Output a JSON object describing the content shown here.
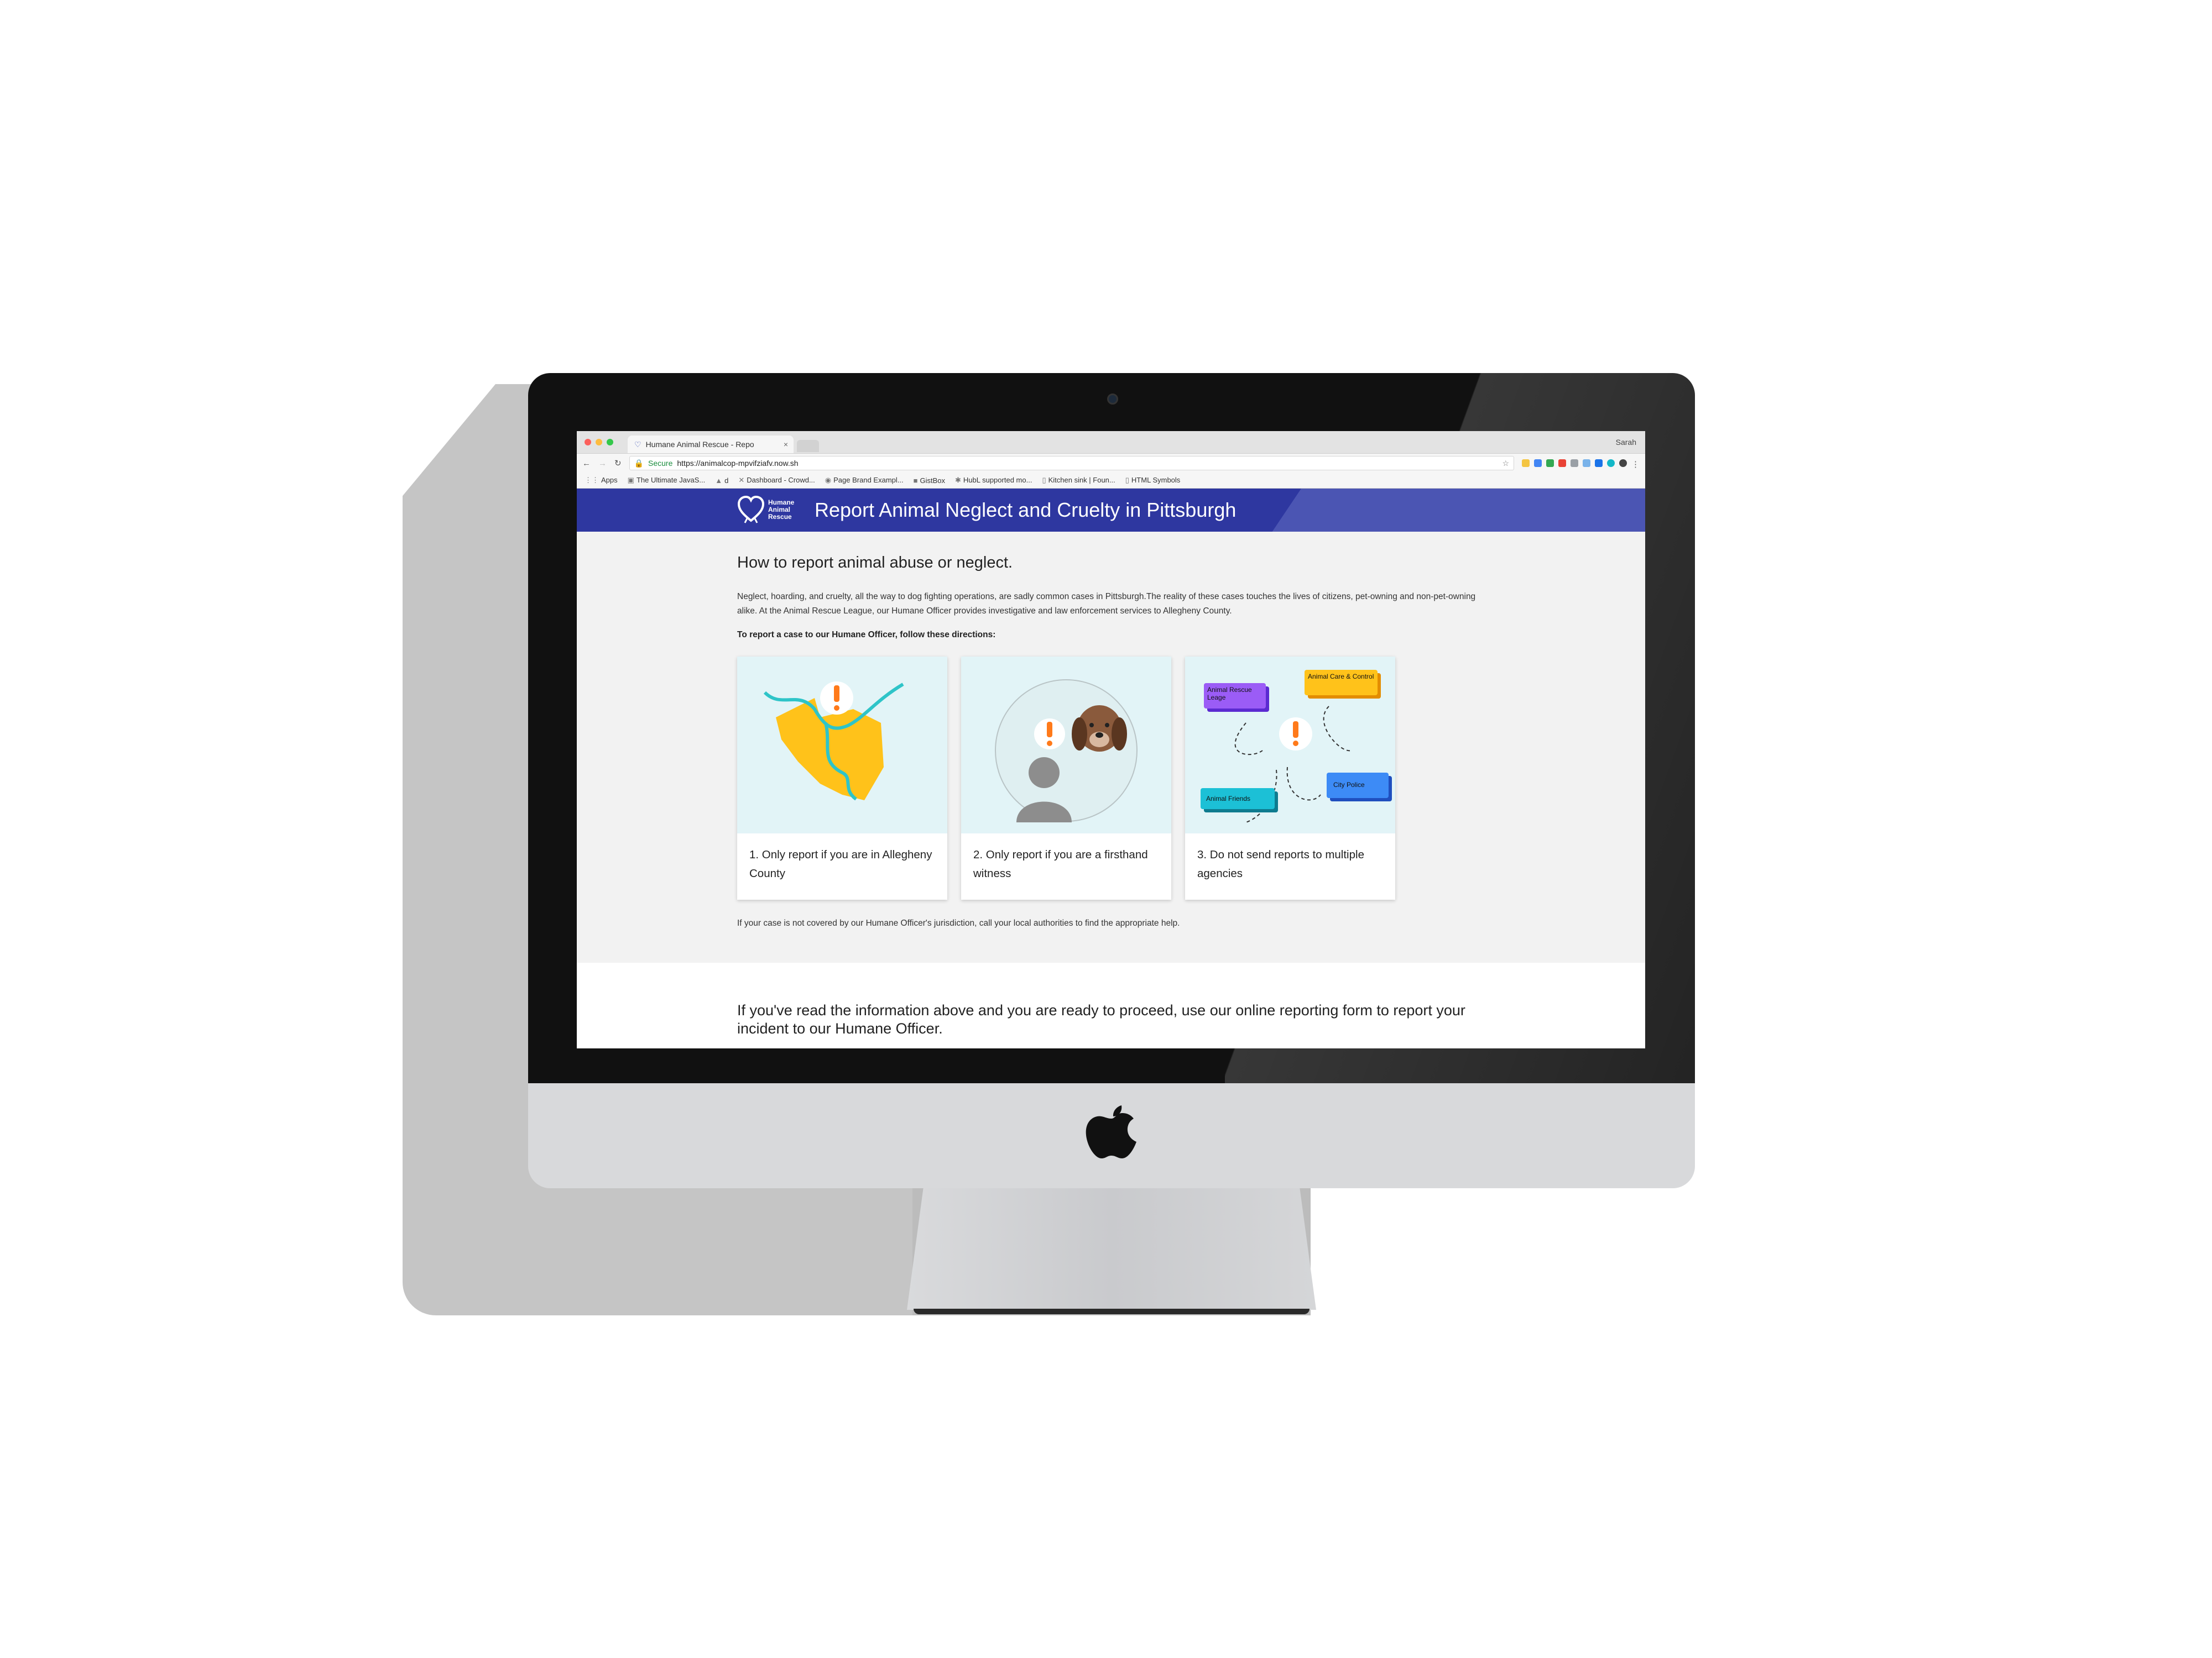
{
  "browser": {
    "tab_title": "Humane Animal Rescue - Repo",
    "tab_close": "×",
    "profile_name": "Sarah",
    "secure_label": "Secure",
    "url": "https://animalcop-mpvifziafv.now.sh",
    "bookmarks": [
      {
        "label": "Apps",
        "icon": "apps-grid-icon"
      },
      {
        "label": "The Ultimate JavaS...",
        "icon": "bookmark-icon"
      },
      {
        "label": "d",
        "icon": "drive-icon"
      },
      {
        "label": "Dashboard - Crowd...",
        "icon": "crowd-icon"
      },
      {
        "label": "Page Brand Exampl...",
        "icon": "bookmark-icon"
      },
      {
        "label": "GistBox",
        "icon": "gistbox-icon"
      },
      {
        "label": "HubL supported mo...",
        "icon": "hubspot-icon"
      },
      {
        "label": "Kitchen sink | Foun...",
        "icon": "page-icon"
      },
      {
        "label": "HTML Symbols",
        "icon": "page-icon"
      }
    ]
  },
  "site": {
    "logo_text": [
      "Humane",
      "Animal",
      "Rescue"
    ],
    "title": "Report Animal Neglect and Cruelty in Pittsburgh",
    "header_colors": {
      "dark": "#2e37a0",
      "light": "#4b55b3"
    }
  },
  "main": {
    "heading": "How to report animal abuse or neglect.",
    "intro": "Neglect, hoarding, and cruelty, all the way to dog fighting operations, are sadly common cases in Pittsburgh.The reality of these cases touches the lives of citizens, pet-owning and non-pet-owning alike. At the Animal Rescue League, our Humane Officer provides investigative and law enforcement services to Allegheny County.",
    "directions": "To report a case to our Humane Officer, follow these directions:",
    "cards": [
      {
        "caption": "1. Only report if you are in Allegheny County",
        "illustration": "allegheny-county-map"
      },
      {
        "caption": "2. Only report if you are a firsthand witness",
        "illustration": "witness-with-dog"
      },
      {
        "caption": "3. Do not send reports to multiple agencies",
        "illustration": "agencies-network",
        "agencies": [
          "Animal Rescue Leage",
          "Animal Care & Control",
          "Animal Friends",
          "City Police"
        ]
      }
    ],
    "footnote": "If your case is not covered by our Humane Officer's jurisdiction, call your local authorities to find the appropriate help.",
    "proceed_text": "If you've read the information above and you are ready to proceed, use our online reporting form to report your incident to our Humane Officer."
  }
}
